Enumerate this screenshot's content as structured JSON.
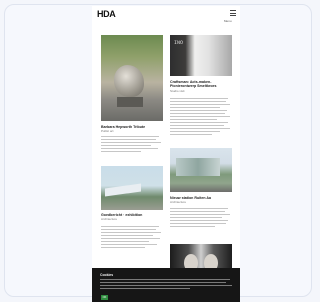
{
  "site": {
    "logo": "HDA",
    "menu_label": "Menu"
  },
  "articles": [
    {
      "title": "Barbara Hepworth Tribute",
      "meta": "Public art"
    },
    {
      "title": "Craftsman: Acts-maken-Pionierontwerp Smeltkroes",
      "meta": "Studio visit"
    },
    {
      "title": "Goedbericht · exhibition",
      "meta": "Architecture"
    },
    {
      "title": "Nieuw station Ruiten Aa",
      "meta": "Architecture"
    }
  ],
  "cookie_banner": {
    "title": "Cookies",
    "accept_label": "OK"
  },
  "colors": {
    "cookie_bg": "#161616",
    "accept_button": "#2e8b3e"
  }
}
